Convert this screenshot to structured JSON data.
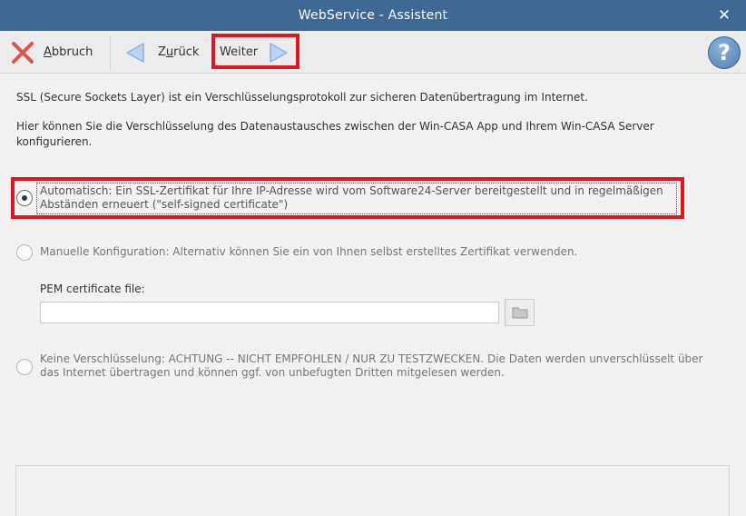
{
  "window": {
    "title": "WebService - Assistent",
    "close_glyph": "✕"
  },
  "toolbar": {
    "cancel_label_u": "A",
    "cancel_label_rest": "bbruch",
    "back_label_pre": "Z",
    "back_label_u": "u",
    "back_label_rest": "rück",
    "next_label": "Weiter",
    "help_glyph": "?"
  },
  "content": {
    "intro": "SSL (Secure Sockets Layer) ist ein Verschlüsselungsprotokoll zur sicheren Datenübertragung im Internet.",
    "description_line1": "Hier können Sie die Verschlüsselung des Datenaustausches zwischen der Win-CASA App und Ihrem Win-CASA Server",
    "description_line2": "konfigurieren.",
    "options": [
      {
        "line1": "Automatisch: Ein SSL-Zertifikat für Ihre IP-Adresse wird vom Software24-Server bereitgestellt und in regelmäßigen",
        "line2": "Abständen erneuert (\"self-signed certificate\")",
        "checked": true
      },
      {
        "line1": "Manuelle Konfiguration: Alternativ können Sie ein von Ihnen selbst erstelltes Zertifikat verwenden.",
        "checked": false
      },
      {
        "line1": "Keine Verschlüsselung: ACHTUNG -- NICHT EMPFOHLEN / NUR ZU TESTZWECKEN. Die Daten werden unverschlüsselt über",
        "line2": "das Internet übertragen und können ggf. von unbefugten Dritten mitgelesen werden.",
        "checked": false
      }
    ],
    "pem_label": "PEM certificate file:",
    "pem_value": ""
  },
  "colors": {
    "titlebar": "#3d6a95",
    "highlight": "#e2141f",
    "cancel_x": "#e0534a",
    "arrow": "#9ec3ea"
  },
  "icons": [
    "close-icon",
    "cancel-x-icon",
    "back-arrow-icon",
    "next-arrow-icon",
    "help-icon",
    "folder-icon"
  ]
}
